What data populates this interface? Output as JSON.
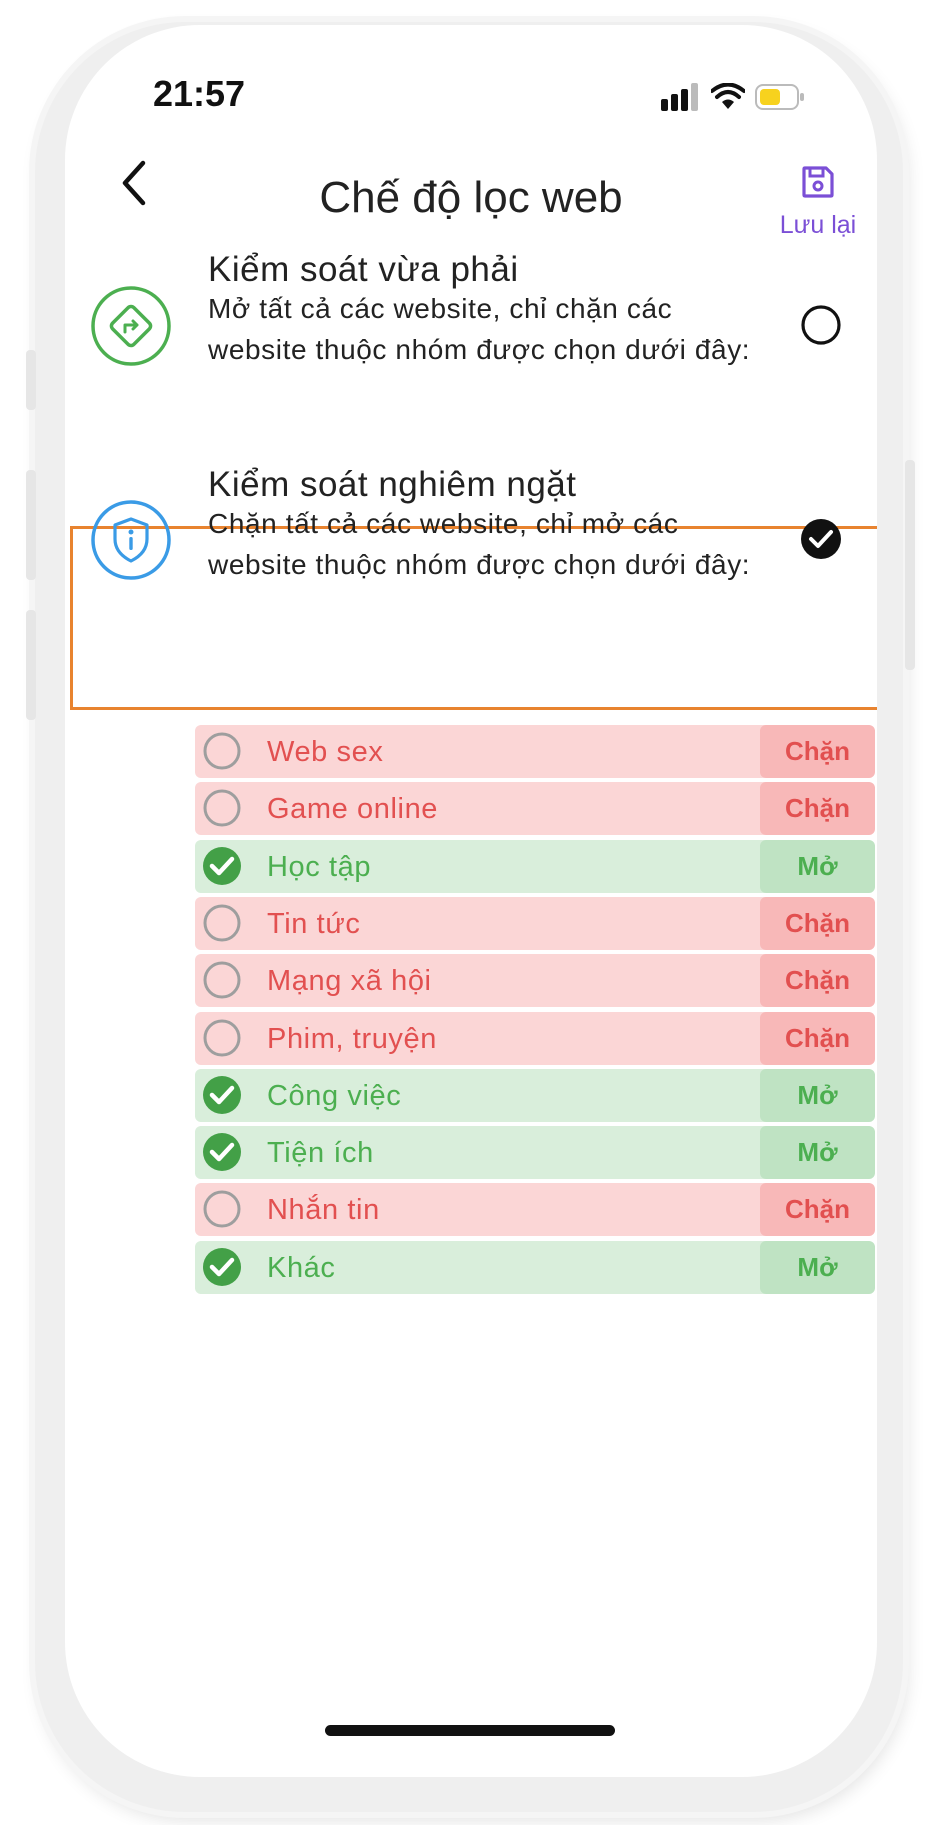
{
  "status_bar": {
    "time": "21:57",
    "icons": [
      "signal-icon",
      "wifi-icon",
      "battery-icon"
    ]
  },
  "header": {
    "title": "Chế độ lọc web",
    "save_label": "Lưu lại",
    "back_icon": "back-arrow-icon",
    "save_icon": "save-icon"
  },
  "modes": [
    {
      "title": "Kiểm soát vừa phải",
      "description": "Mở tất cả các website, chỉ chặn các website thuộc nhóm được chọn dưới đây:",
      "icon": "route-sign-icon",
      "selected": false
    },
    {
      "title": "Kiểm soát nghiêm ngặt",
      "description": "Chặn tất cả các website, chỉ mở các website thuộc nhóm được chọn dưới đây:",
      "icon": "shield-info-icon",
      "selected": true
    }
  ],
  "categories": [
    {
      "label": "Web sex",
      "status": "Chặn",
      "checked": false
    },
    {
      "label": "Game online",
      "status": "Chặn",
      "checked": false
    },
    {
      "label": "Học tập",
      "status": "Mở",
      "checked": true
    },
    {
      "label": "Tin tức",
      "status": "Chặn",
      "checked": false
    },
    {
      "label": "Mạng xã hội",
      "status": "Chặn",
      "checked": false
    },
    {
      "label": "Phim, truyện",
      "status": "Chặn",
      "checked": false
    },
    {
      "label": "Công việc",
      "status": "Mở",
      "checked": true
    },
    {
      "label": "Tiện ích",
      "status": "Mở",
      "checked": true
    },
    {
      "label": "Nhắn tin",
      "status": "Chặn",
      "checked": false
    },
    {
      "label": "Khác",
      "status": "Mở",
      "checked": true
    }
  ],
  "colors": {
    "accent": "#7b4fd6",
    "block_text": "#e25050",
    "block_bg": "#fbd6d6",
    "open_text": "#4caf50",
    "open_bg": "#d9eedb",
    "highlight": "#e8832f"
  }
}
